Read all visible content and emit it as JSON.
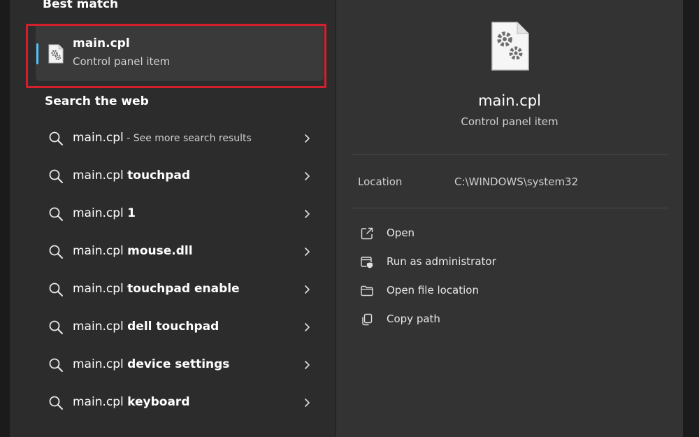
{
  "best_match": {
    "section_title": "Best match",
    "name": "main.cpl",
    "type": "Control panel item"
  },
  "web": {
    "section_title": "Search the web",
    "rows": [
      {
        "query": "main.cpl",
        "suffix": "",
        "hint": " - See more search results"
      },
      {
        "query": "main.cpl ",
        "suffix": "touchpad",
        "hint": ""
      },
      {
        "query": "main.cpl ",
        "suffix": "1",
        "hint": ""
      },
      {
        "query": "main.cpl ",
        "suffix": "mouse.dll",
        "hint": ""
      },
      {
        "query": "main.cpl ",
        "suffix": "touchpad enable",
        "hint": ""
      },
      {
        "query": "main.cpl ",
        "suffix": "dell touchpad",
        "hint": ""
      },
      {
        "query": "main.cpl ",
        "suffix": "device settings",
        "hint": ""
      },
      {
        "query": "main.cpl ",
        "suffix": "keyboard",
        "hint": ""
      }
    ]
  },
  "preview": {
    "name": "main.cpl",
    "type": "Control panel item",
    "location_label": "Location",
    "location_value": "C:\\WINDOWS\\system32",
    "actions": [
      {
        "label": "Open",
        "icon": "open-icon"
      },
      {
        "label": "Run as administrator",
        "icon": "shield-icon"
      },
      {
        "label": "Open file location",
        "icon": "folder-icon"
      },
      {
        "label": "Copy path",
        "icon": "copy-icon"
      }
    ]
  },
  "colors": {
    "accent": "#4cc2ff",
    "highlight_border": "#d4202c",
    "left_pane_bg": "#2c2c2c",
    "right_pane_bg": "#333333"
  }
}
